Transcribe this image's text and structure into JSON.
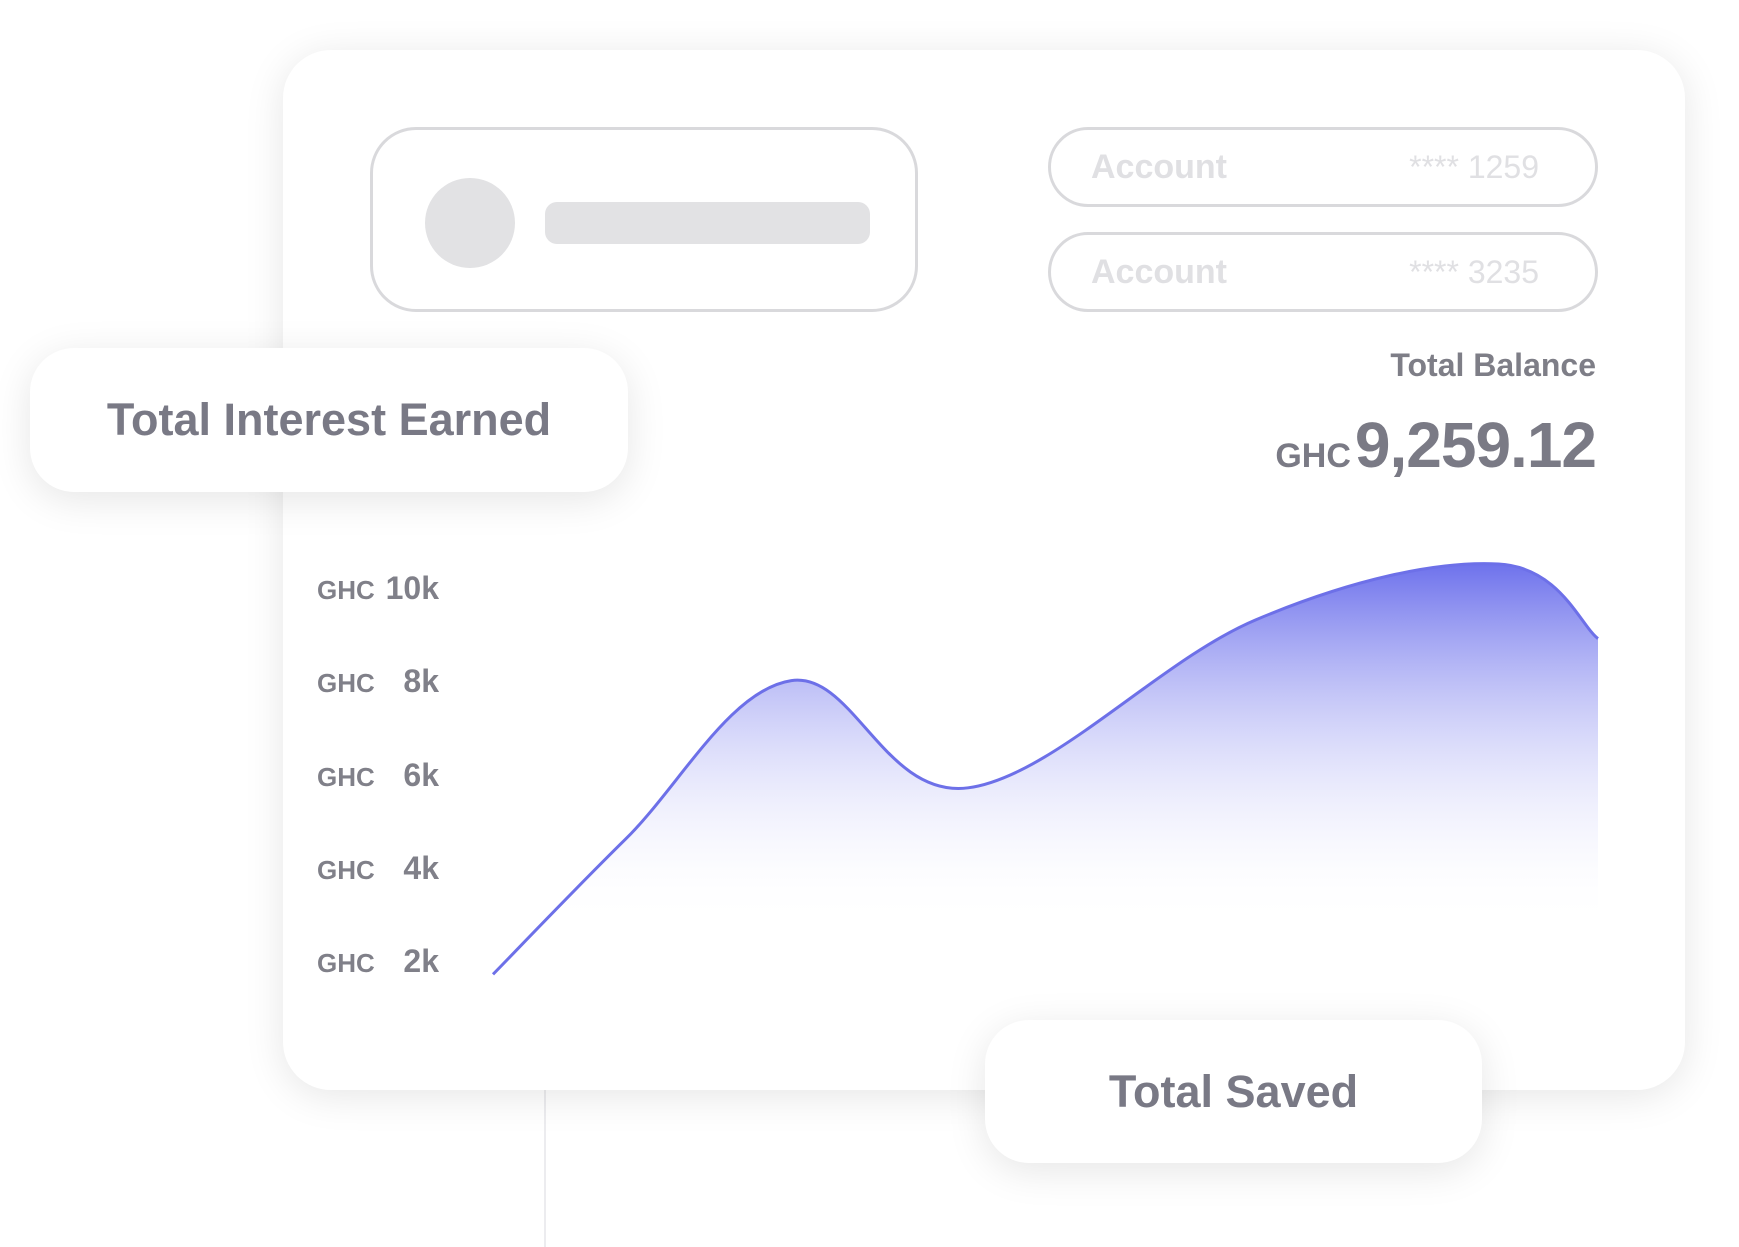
{
  "accounts": [
    {
      "label": "Account",
      "number": "**** 1259"
    },
    {
      "label": "Account",
      "number": "**** 3235"
    }
  ],
  "balance": {
    "label": "Total Balance",
    "currency": "GHC",
    "amount": "9,259.12"
  },
  "cards": {
    "interest": "Total Interest Earned",
    "saved": "Total Saved"
  },
  "chart_data": {
    "type": "area",
    "y_ticks": [
      {
        "currency": "GHC",
        "value": "10k"
      },
      {
        "currency": "GHC",
        "value": "8k"
      },
      {
        "currency": "GHC",
        "value": "6k"
      },
      {
        "currency": "GHC",
        "value": "4k"
      },
      {
        "currency": "GHC",
        "value": "2k"
      }
    ],
    "ylim": [
      2000,
      10000
    ],
    "series": [
      {
        "x": [
          0,
          0.12,
          0.27,
          0.43,
          0.69,
          0.91,
          1.0
        ],
        "values": [
          1800,
          4700,
          8100,
          5800,
          9400,
          10600,
          9000
        ]
      }
    ],
    "colors": {
      "line": "#6d70e8",
      "fill_top": "#6e72ec",
      "fill_bottom": "#ffffff"
    }
  }
}
